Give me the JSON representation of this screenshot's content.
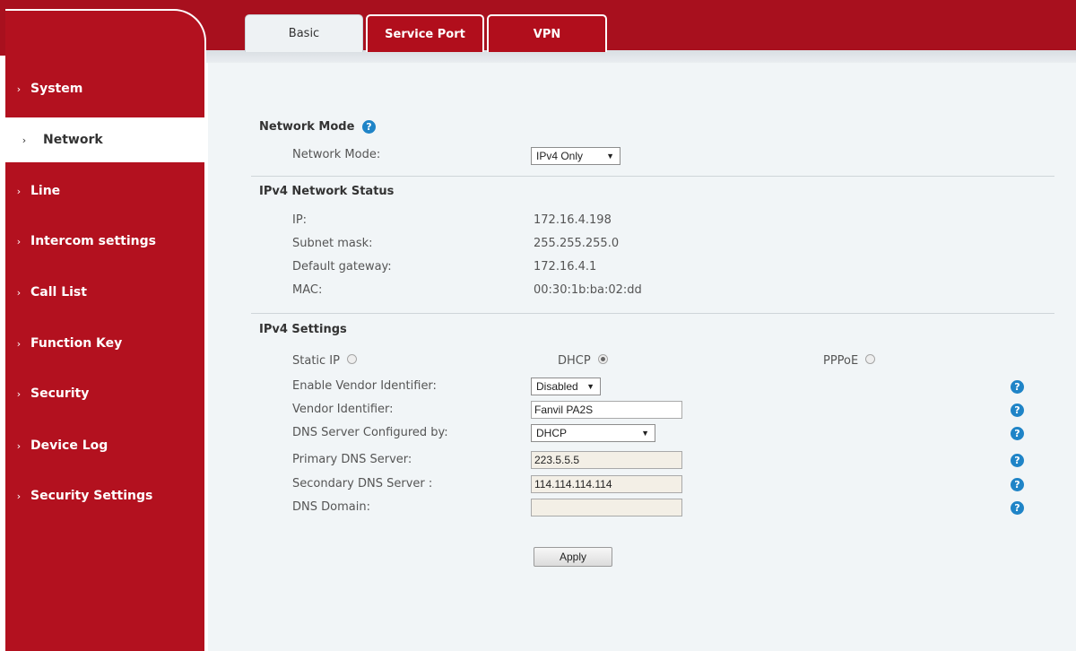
{
  "tabs": {
    "basic": "Basic",
    "service_port": "Service Port",
    "vpn": "VPN"
  },
  "sidebar": {
    "chevron": "›",
    "items": [
      {
        "label": "System"
      },
      {
        "label": "Network",
        "active": true
      },
      {
        "label": "Line"
      },
      {
        "label": "Intercom settings"
      },
      {
        "label": "Call List"
      },
      {
        "label": "Function Key"
      },
      {
        "label": "Security"
      },
      {
        "label": "Device Log"
      },
      {
        "label": "Security Settings"
      }
    ]
  },
  "network_mode": {
    "title": "Network Mode",
    "label": "Network Mode:",
    "value": "IPv4 Only"
  },
  "status": {
    "title": "IPv4 Network Status",
    "ip_label": "IP:",
    "ip": "172.16.4.198",
    "subnet_label": "Subnet mask:",
    "subnet": "255.255.255.0",
    "gateway_label": "Default gateway:",
    "gateway": "172.16.4.1",
    "mac_label": "MAC:",
    "mac": "00:30:1b:ba:02:dd"
  },
  "settings": {
    "title": "IPv4 Settings",
    "static_ip_label": "Static IP",
    "dhcp_label": "DHCP",
    "pppoe_label": "PPPoE",
    "selected_mode": "DHCP",
    "vendor_enable_label": "Enable Vendor Identifier:",
    "vendor_enable_value": "Disabled",
    "vendor_id_label": "Vendor Identifier:",
    "vendor_id_value": "Fanvil PA2S",
    "dns_config_label": "DNS Server Configured by:",
    "dns_config_value": "DHCP",
    "primary_dns_label": "Primary DNS Server:",
    "primary_dns_value": "223.5.5.5",
    "secondary_dns_label": "Secondary DNS Server :",
    "secondary_dns_value": "114.114.114.114",
    "dns_domain_label": "DNS Domain:",
    "dns_domain_value": ""
  },
  "apply_label": "Apply",
  "icons": {
    "help": "?",
    "dropdown": "▼"
  },
  "colors": {
    "brand_red": "#b3111f",
    "help_blue": "#1f84c7",
    "content_bg": "#f1f5f7"
  }
}
